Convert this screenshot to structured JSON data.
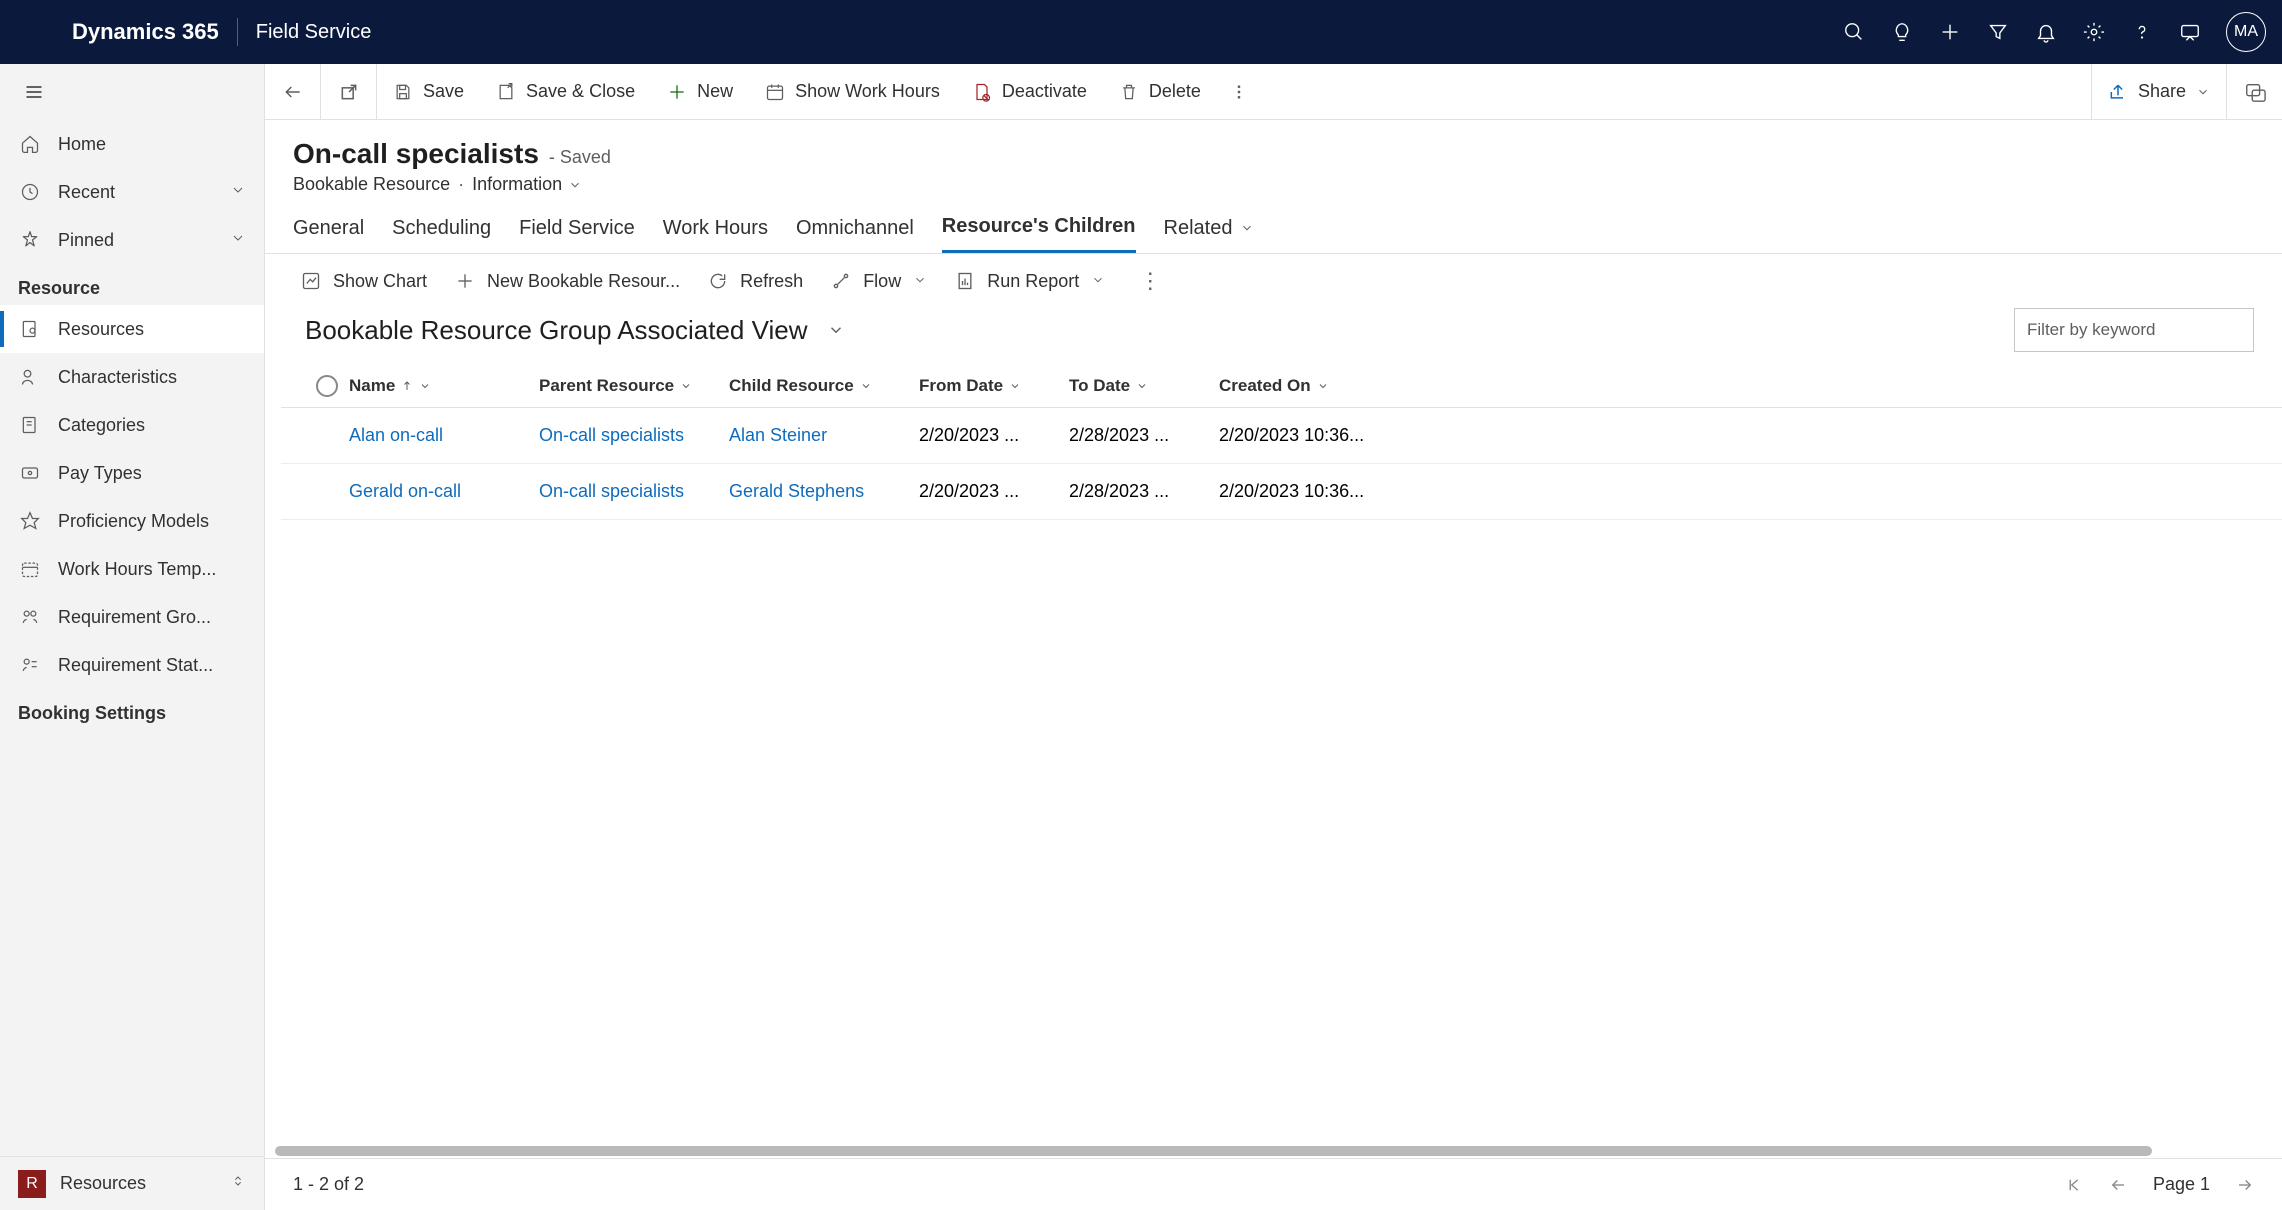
{
  "topbar": {
    "brand": "Dynamics 365",
    "app": "Field Service",
    "avatar": "MA"
  },
  "sidebar": {
    "home": "Home",
    "recent": "Recent",
    "pinned": "Pinned",
    "section1": "Resource",
    "items": [
      {
        "label": "Resources"
      },
      {
        "label": "Characteristics"
      },
      {
        "label": "Categories"
      },
      {
        "label": "Pay Types"
      },
      {
        "label": "Proficiency Models"
      },
      {
        "label": "Work Hours Temp..."
      },
      {
        "label": "Requirement Gro..."
      },
      {
        "label": "Requirement Stat..."
      }
    ],
    "section2": "Booking Settings",
    "area_badge": "R",
    "area_label": "Resources"
  },
  "cmdbar": {
    "save": "Save",
    "save_close": "Save & Close",
    "new": "New",
    "show_hours": "Show Work Hours",
    "deactivate": "Deactivate",
    "delete": "Delete",
    "share": "Share"
  },
  "record": {
    "title": "On-call specialists",
    "saved": "- Saved",
    "entity": "Bookable Resource",
    "form": "Information"
  },
  "tabs": {
    "t0": "General",
    "t1": "Scheduling",
    "t2": "Field Service",
    "t3": "Work Hours",
    "t4": "Omnichannel",
    "t5": "Resource's Children",
    "t6": "Related"
  },
  "subcmd": {
    "show_chart": "Show Chart",
    "new_child": "New Bookable Resour...",
    "refresh": "Refresh",
    "flow": "Flow",
    "run_report": "Run Report"
  },
  "view": {
    "title": "Bookable Resource Group Associated View",
    "filter_placeholder": "Filter by keyword"
  },
  "grid": {
    "headers": {
      "name": "Name",
      "parent": "Parent Resource",
      "child": "Child Resource",
      "from": "From Date",
      "to": "To Date",
      "created": "Created On"
    },
    "rows": [
      {
        "name": "Alan on-call",
        "parent": "On-call specialists",
        "child": "Alan Steiner",
        "from": "2/20/2023 ...",
        "to": "2/28/2023 ...",
        "created": "2/20/2023 10:36..."
      },
      {
        "name": "Gerald on-call",
        "parent": "On-call specialists",
        "child": "Gerald Stephens",
        "from": "2/20/2023 ...",
        "to": "2/28/2023 ...",
        "created": "2/20/2023 10:36..."
      }
    ]
  },
  "footer": {
    "count": "1 - 2 of 2",
    "page": "Page 1"
  }
}
